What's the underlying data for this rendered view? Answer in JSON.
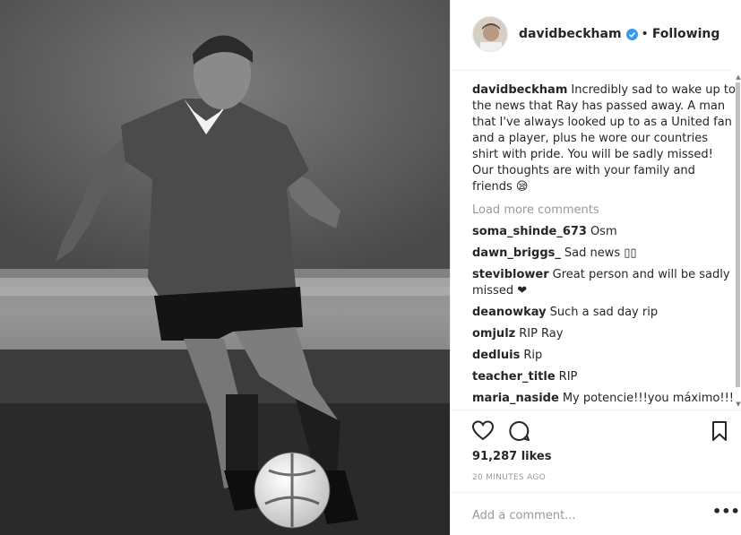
{
  "post": {
    "author": "davidbeckham",
    "follow_separator": "•",
    "follow_status": "Following",
    "caption_user": "davidbeckham",
    "caption_text": "Incredibly sad to wake up to the news that Ray has passed away. A man that I've always looked up to as a United fan and a player, plus he wore our countries shirt with pride. You will be sadly missed! Our thoughts are with your family and friends 😪",
    "load_more": "Load more comments",
    "comments": [
      {
        "user": "soma_shinde_673",
        "text": "Osm"
      },
      {
        "user": "dawn_briggs_",
        "text": "Sad news ▯▯"
      },
      {
        "user": "steviblower",
        "text": "Great person and will be sadly missed ❤"
      },
      {
        "user": "deanowkay",
        "text": "Such a sad day rip"
      },
      {
        "user": "omjulz",
        "text": "RIP Ray"
      },
      {
        "user": "dedluis",
        "text": "Rip"
      },
      {
        "user": "teacher_title",
        "text": "RIP"
      },
      {
        "user": "maria_naside",
        "text": "My potencie!!!you máximo!!!"
      }
    ],
    "likes": "91,287 likes",
    "time": "20 MINUTES AGO",
    "comment_placeholder": "Add a comment...",
    "more_options": "•••"
  },
  "icons": {
    "verified": "verified-badge-icon",
    "like": "heart-icon",
    "comment": "speech-bubble-icon",
    "save": "bookmark-icon",
    "more": "ellipsis-icon"
  },
  "colors": {
    "verified_blue": "#3897f0",
    "text": "#262626",
    "muted": "#999999",
    "border": "#efefef"
  }
}
